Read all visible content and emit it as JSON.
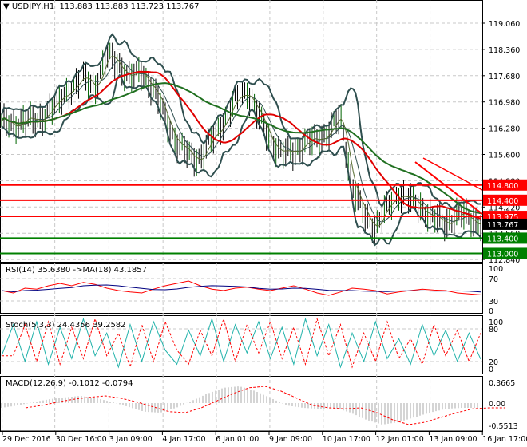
{
  "header": {
    "symbol_label": "USDJPY,H1",
    "ohlc": "113.883 113.883 113.723 113.767"
  },
  "price_axis": [
    "119.060",
    "118.360",
    "117.680",
    "116.980",
    "116.280",
    "115.600",
    "114.880",
    "114.220",
    "113.560",
    "112.840"
  ],
  "levels": [
    {
      "label": "114.800",
      "price": 114.8,
      "color": "#ff0000"
    },
    {
      "label": "114.400",
      "price": 114.4,
      "color": "#ff0000"
    },
    {
      "label": "113.975",
      "price": 113.975,
      "color": "#ff0000"
    },
    {
      "label": "113.767",
      "price": 113.767,
      "color": "#000000"
    },
    {
      "label": "113.400",
      "price": 113.4,
      "color": "#008000"
    },
    {
      "label": "113.000",
      "price": 113.0,
      "color": "#008000"
    }
  ],
  "rsi": {
    "label": "RSI(14) 35.6380  ->MA(18) 43.1857",
    "axis": [
      "100",
      "70",
      "30",
      "0"
    ]
  },
  "stoch": {
    "label": "Stoch(5,3,3) 24.4356 39.2582",
    "axis": [
      "100",
      "80",
      "20",
      "0"
    ]
  },
  "macd": {
    "label": "MACD(12,26,9) -0.1012 -0.0794",
    "axis": [
      "0.3665",
      "0.00",
      "-0.5513"
    ]
  },
  "time_axis": [
    "29 Dec 2016",
    "30 Dec 16:00",
    "3 Jan 09:00",
    "4 Jan 17:00",
    "6 Jan 01:00",
    "9 Jan 09:00",
    "10 Jan 17:00",
    "12 Jan 01:00",
    "13 Jan 09:00",
    "16 Jan 17:00"
  ],
  "chart_data": {
    "type": "line",
    "price_ylim": [
      112.84,
      119.06
    ],
    "close": [
      116.5,
      116.3,
      116.6,
      116.4,
      116.8,
      117.0,
      117.4,
      117.6,
      117.4,
      118.2,
      118.0,
      117.6,
      117.8,
      117.3,
      116.6,
      115.9,
      115.6,
      115.5,
      116.0,
      116.5,
      117.0,
      117.3,
      116.6,
      116.0,
      115.6,
      115.7,
      115.9,
      116.0,
      116.2,
      116.6,
      114.8,
      114.0,
      113.7,
      114.2,
      114.6,
      114.4,
      114.2,
      113.9,
      113.8,
      114.0,
      113.95,
      113.767
    ],
    "rsi": [
      45,
      40,
      50,
      48,
      55,
      60,
      55,
      62,
      58,
      50,
      45,
      42,
      40,
      48,
      55,
      60,
      65,
      55,
      48,
      45,
      50,
      52,
      48,
      45,
      50,
      55,
      48,
      40,
      35,
      42,
      50,
      48,
      45,
      38,
      42,
      45,
      48,
      46,
      45,
      40,
      38,
      36
    ],
    "stoch": [
      30,
      85,
      20,
      90,
      15,
      80,
      25,
      95,
      30,
      70,
      10,
      85,
      20,
      90,
      40,
      15,
      75,
      30,
      95,
      20,
      85,
      35,
      90,
      25,
      80,
      15,
      95,
      30,
      85,
      10,
      70,
      20,
      90,
      25,
      60,
      15,
      85,
      30,
      75,
      20,
      70,
      24
    ],
    "macd": [
      -0.1,
      -0.05,
      0.02,
      0.08,
      0.12,
      0.15,
      0.1,
      0.02,
      -0.08,
      -0.18,
      -0.2,
      -0.1,
      0.05,
      0.2,
      0.32,
      0.35,
      0.25,
      0.1,
      -0.05,
      -0.1,
      -0.12,
      -0.1,
      -0.2,
      -0.35,
      -0.45,
      -0.4,
      -0.3,
      -0.2,
      -0.12,
      -0.1,
      -0.1
    ]
  }
}
